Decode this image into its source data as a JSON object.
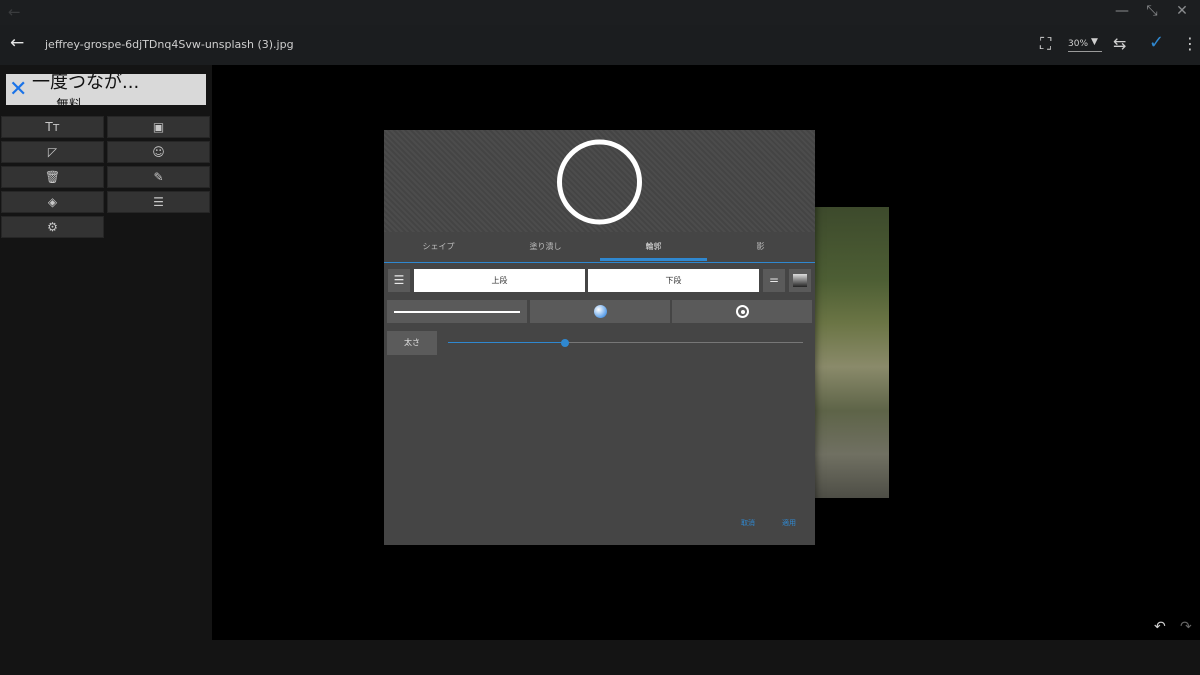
{
  "window": {
    "back_glyph": "←",
    "minimize": "—",
    "restore": "⤡",
    "close": "✕"
  },
  "toolbar": {
    "back_glyph": "←",
    "filename": "jeffrey-grospe-6djTDnq4Svw-unsplash (3).jpg",
    "fullscreen_glyph": "⛶",
    "zoom_value": "30%",
    "zoom_arrow": "▼",
    "swap_glyph": "⇆",
    "confirm_glyph": "✓",
    "menu_glyph": "⋮"
  },
  "ad": {
    "title": "一度つなが...",
    "close_glyph": "✕",
    "sub": "無料"
  },
  "tools": {
    "text": "Tт",
    "image": "▣",
    "shape": "◸",
    "emoji": "☺",
    "delete": "🗑",
    "draw": "✎",
    "layers": "◈",
    "align": "☰",
    "settings": "⚙"
  },
  "dialog": {
    "tabs": [
      "シェイプ",
      "塗り潰し",
      "輪郭",
      "影"
    ],
    "active_tab": 2,
    "lines_glyph": "☰",
    "top_label": "上段",
    "bottom_label": "下段",
    "equal_glyph": "=",
    "slider": {
      "label": "太さ",
      "value": 0.33
    },
    "cancel": "取消",
    "apply": "適用"
  },
  "bottom": {
    "undo": "↶",
    "redo": "↷"
  },
  "colors": {
    "accent": "#2f88d0",
    "dialog_bg": "#454545",
    "panel_bg": "#141414"
  }
}
